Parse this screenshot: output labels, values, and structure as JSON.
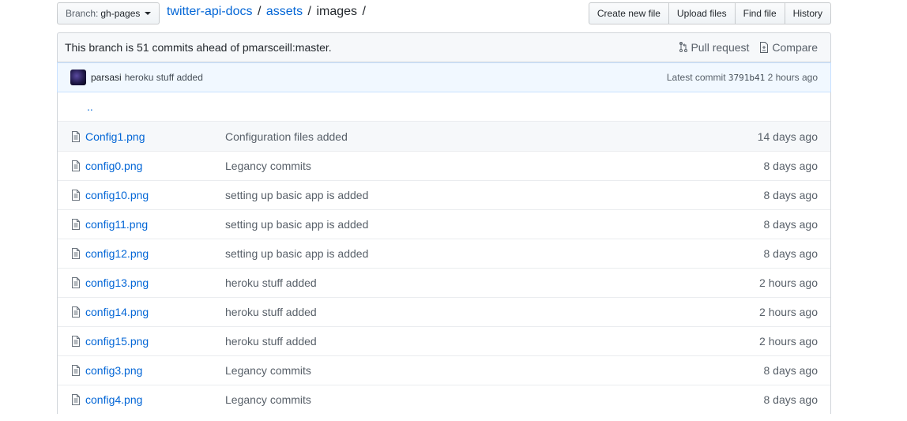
{
  "branch": {
    "prefix": "Branch:",
    "name": "gh-pages"
  },
  "breadcrumb": {
    "repo": "twitter-api-docs",
    "folder": "assets",
    "current": "images",
    "sep": "/"
  },
  "actions": {
    "create": "Create new file",
    "upload": "Upload files",
    "find": "Find file",
    "history": "History"
  },
  "branch_info": {
    "text": "This branch is 51 commits ahead of pmarsceill:master.",
    "pull_request": "Pull request",
    "compare": "Compare"
  },
  "commit": {
    "author": "parsasi",
    "message": "heroku stuff added",
    "latest_label": "Latest commit",
    "sha": "3791b41",
    "age": "2 hours ago"
  },
  "up_dir": "..",
  "files": [
    {
      "name": "Config1.png",
      "message": "Configuration files added",
      "age": "14 days ago"
    },
    {
      "name": "config0.png",
      "message": "Legancy commits",
      "age": "8 days ago"
    },
    {
      "name": "config10.png",
      "message": "setting up basic app is added",
      "age": "8 days ago"
    },
    {
      "name": "config11.png",
      "message": "setting up basic app is added",
      "age": "8 days ago"
    },
    {
      "name": "config12.png",
      "message": "setting up basic app is added",
      "age": "8 days ago"
    },
    {
      "name": "config13.png",
      "message": "heroku stuff added",
      "age": "2 hours ago"
    },
    {
      "name": "config14.png",
      "message": "heroku stuff added",
      "age": "2 hours ago"
    },
    {
      "name": "config15.png",
      "message": "heroku stuff added",
      "age": "2 hours ago"
    },
    {
      "name": "config3.png",
      "message": "Legancy commits",
      "age": "8 days ago"
    },
    {
      "name": "config4.png",
      "message": "Legancy commits",
      "age": "8 days ago"
    }
  ]
}
